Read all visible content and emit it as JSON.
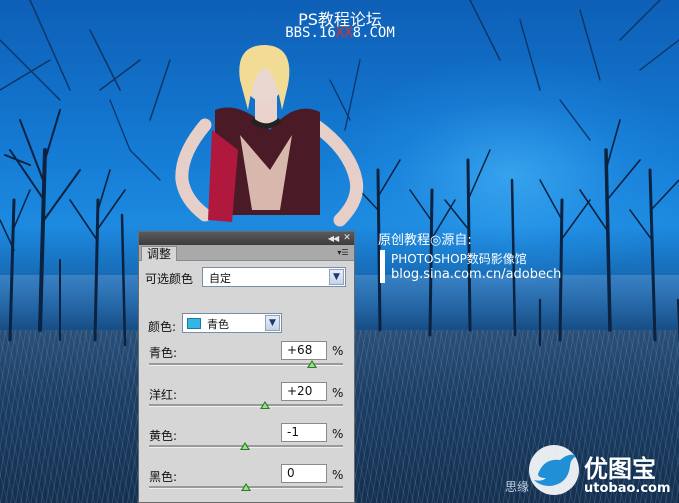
{
  "watermark": {
    "title": "PS教程论坛",
    "url_prefix": "BBS.16",
    "url_highlight": "XX",
    "url_suffix": "8.COM"
  },
  "credit": {
    "line1": "原创教程◎源自:",
    "line2": "PHOTOSHOP数码影像馆",
    "line3": "blog.sina.com.cn/adobech"
  },
  "logo": {
    "name": "优图宝",
    "domain": "utobao.com",
    "signature": "思缘"
  },
  "panel": {
    "tab_label": "调整",
    "adjustment_label": "可选颜色",
    "preset_value": "自定",
    "color_label": "颜色:",
    "color_value": "青色",
    "swatch_color": "#33b6e6",
    "sliders": [
      {
        "label": "青色:",
        "value": "+68",
        "unit": "%",
        "level": 84
      },
      {
        "label": "洋红:",
        "value": "+20",
        "unit": "%",
        "level": 60
      },
      {
        "label": "黄色:",
        "value": "-1",
        "unit": "%",
        "level": 49.5
      },
      {
        "label": "黑色:",
        "value": "0",
        "unit": "%",
        "level": 50
      }
    ]
  },
  "colors": {
    "accent_red": "#e0302a",
    "slider_thumb": "#2c7a2a"
  }
}
